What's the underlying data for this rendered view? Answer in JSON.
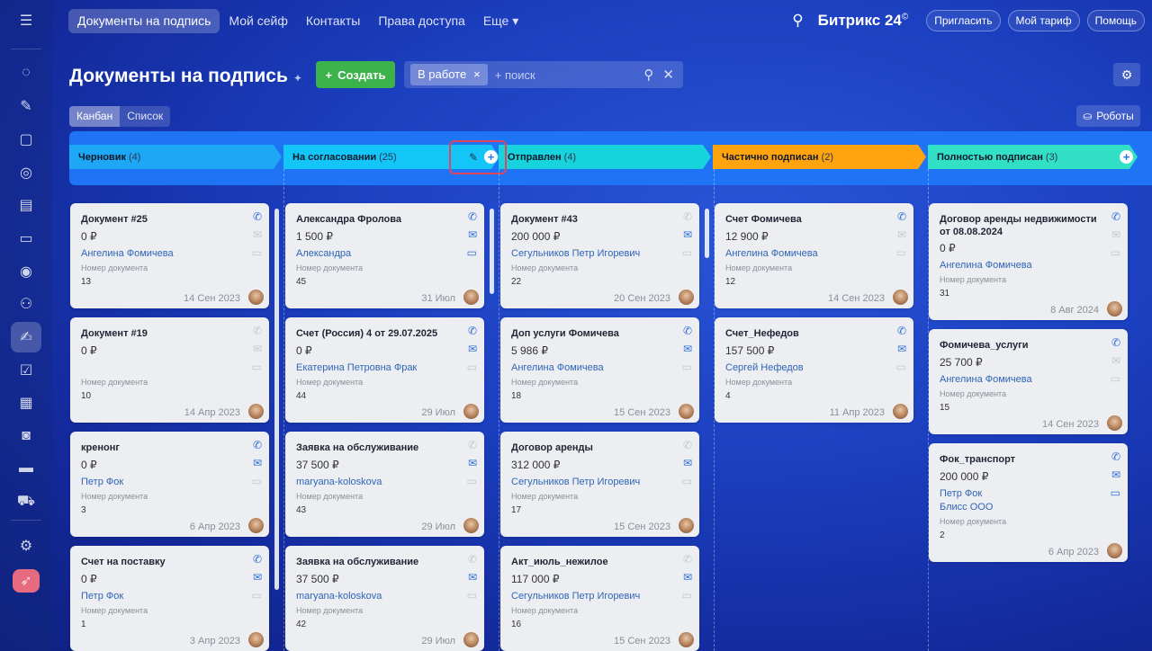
{
  "topnav": [
    "Документы на подпись",
    "Мой сейф",
    "Контакты",
    "Права доступа",
    "Еще ▾"
  ],
  "brand": {
    "name": "Битрикс 24",
    "mark": "©"
  },
  "top_buttons": [
    "Пригласить",
    "Мой тариф",
    "Помощь"
  ],
  "page_title": "Документы на подпись",
  "create_label": "Создать",
  "filter": {
    "chip": "В работе",
    "placeholder": "+ поиск"
  },
  "views": [
    "Канбан",
    "Список"
  ],
  "robots_label": "Роботы",
  "label_docnum": "Номер документа",
  "stages": [
    {
      "name": "Черновик",
      "count": "(4)",
      "color": "#1ea7f5"
    },
    {
      "name": "На согласовании",
      "count": "(25)",
      "color": "#14c6f7"
    },
    {
      "name": "Отправлен",
      "count": "(4)",
      "color": "#16d3dc"
    },
    {
      "name": "Частично подписан",
      "count": "(2)",
      "color": "#ffa40e"
    },
    {
      "name": "Полностью подписан",
      "count": "(3)",
      "color": "#32e0c6"
    }
  ],
  "columns": [
    [
      {
        "title": "Документ #25",
        "price": "0 ₽",
        "person": "Ангелина Фомичева",
        "number": "13",
        "date": "14 Сен 2023",
        "icons": [
          1,
          0,
          0
        ]
      },
      {
        "title": "Документ #19",
        "price": "0 ₽",
        "person": "",
        "number": "10",
        "date": "14 Апр 2023",
        "icons": [
          0,
          0,
          0
        ]
      },
      {
        "title": "кренонг",
        "price": "0 ₽",
        "person": "Петр Фок",
        "number": "3",
        "date": "6 Апр 2023",
        "icons": [
          1,
          1,
          0
        ]
      },
      {
        "title": "Счет на поставку",
        "price": "0 ₽",
        "person": "Петр Фок",
        "number": "1",
        "date": "3 Апр 2023",
        "icons": [
          1,
          1,
          0
        ]
      }
    ],
    [
      {
        "title": "Александра Фролова",
        "price": "1 500 ₽",
        "person": "Александра",
        "number": "45",
        "date": "31 Июл",
        "icons": [
          1,
          1,
          1
        ]
      },
      {
        "title": "Счет (Россия) 4 от 29.07.2025",
        "price": "0 ₽",
        "person": "Екатерина Петровна Фрак",
        "number": "44",
        "date": "29 Июл",
        "icons": [
          1,
          1,
          0
        ]
      },
      {
        "title": "Заявка на обслуживание",
        "price": "37 500 ₽",
        "person": "maryana-koloskova",
        "number": "43",
        "date": "29 Июл",
        "icons": [
          0,
          1,
          0
        ]
      },
      {
        "title": "Заявка на обслуживание",
        "price": "37 500 ₽",
        "person": "maryana-koloskova",
        "number": "42",
        "date": "29 Июл",
        "icons": [
          0,
          1,
          0
        ]
      }
    ],
    [
      {
        "title": "Документ #43",
        "price": "200 000 ₽",
        "person": "Сегульников Петр Игоревич",
        "number": "22",
        "date": "20 Сен 2023",
        "icons": [
          0,
          1,
          0
        ]
      },
      {
        "title": "Доп услуги Фомичева",
        "price": "5 986 ₽",
        "person": "Ангелина Фомичева",
        "number": "18",
        "date": "15 Сен 2023",
        "icons": [
          1,
          1,
          0
        ]
      },
      {
        "title": "Договор аренды",
        "price": "312 000 ₽",
        "person": "Сегульников Петр Игоревич",
        "number": "17",
        "date": "15 Сен 2023",
        "icons": [
          0,
          1,
          0
        ]
      },
      {
        "title": "Акт_июль_нежилое",
        "price": "117 000 ₽",
        "person": "Сегульников Петр Игоревич",
        "number": "16",
        "date": "15 Сен 2023",
        "icons": [
          0,
          1,
          0
        ]
      }
    ],
    [
      {
        "title": "Счет Фомичева",
        "price": "12 900 ₽",
        "person": "Ангелина Фомичева",
        "number": "12",
        "date": "14 Сен 2023",
        "icons": [
          1,
          0,
          0
        ]
      },
      {
        "title": "Счет_Нефедов",
        "price": "157 500 ₽",
        "person": "Сергей Нефедов",
        "number": "4",
        "date": "11 Апр 2023",
        "icons": [
          1,
          1,
          0
        ]
      }
    ],
    [
      {
        "title": "Договор аренды недвижимости от 08.08.2024",
        "price": "0 ₽",
        "person": "Ангелина Фомичева",
        "number": "31",
        "date": "8 Авг 2024",
        "icons": [
          1,
          0,
          0
        ]
      },
      {
        "title": "Фомичева_услуги",
        "price": "25 700 ₽",
        "person": "Ангелина Фомичева",
        "number": "15",
        "date": "14 Сен 2023",
        "icons": [
          1,
          0,
          0
        ]
      },
      {
        "title": "Фок_транспорт",
        "price": "200 000 ₽",
        "person": "Петр Фок",
        "company": "Блисс ООО",
        "number": "2",
        "date": "6 Апр 2023",
        "icons": [
          1,
          1,
          1
        ]
      }
    ]
  ]
}
